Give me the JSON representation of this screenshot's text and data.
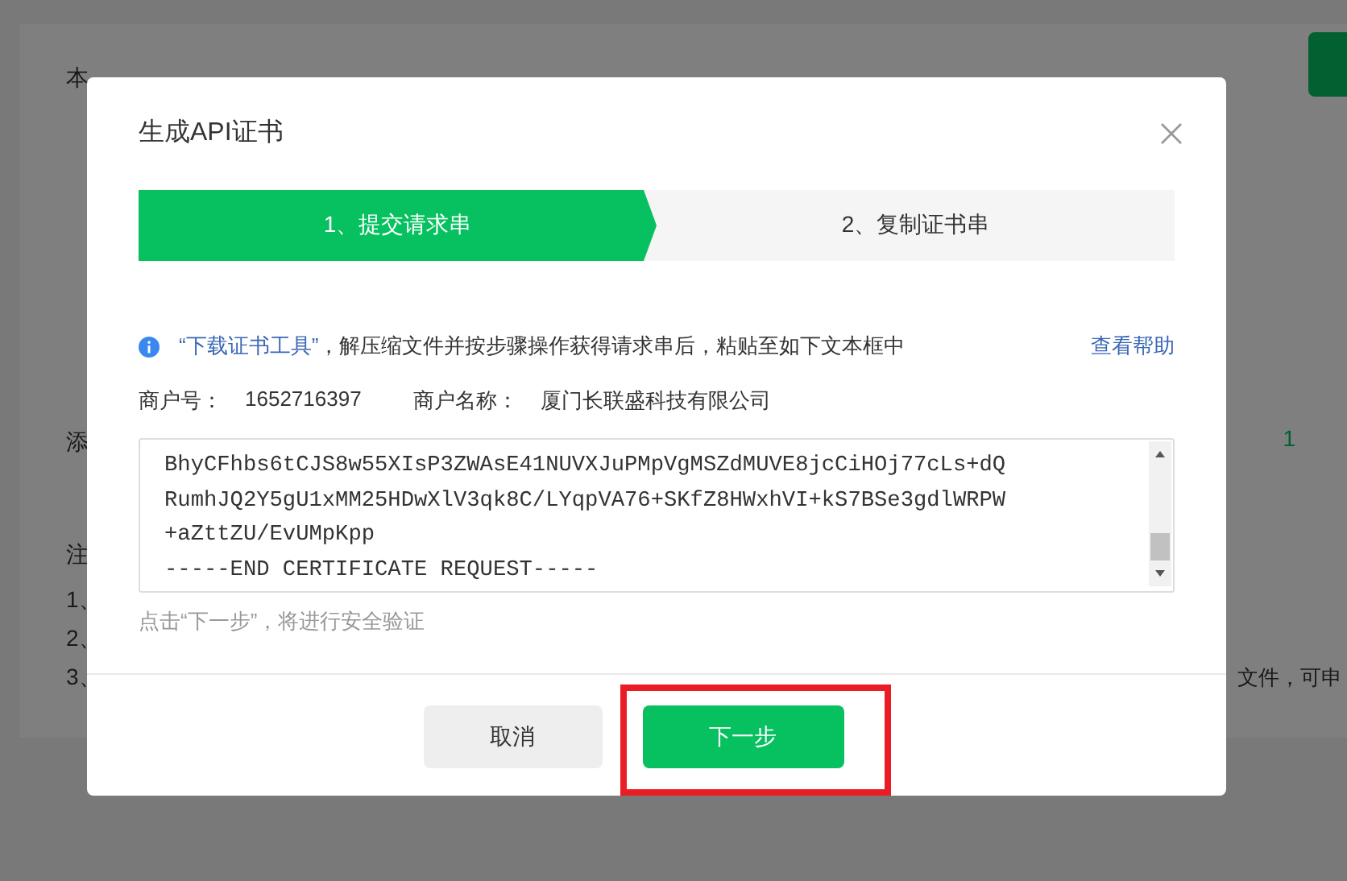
{
  "background_page": {
    "fragments": [
      {
        "text": "本"
      },
      {
        "text": "添"
      },
      {
        "text": "注"
      },
      {
        "text": "1、"
      },
      {
        "text": "2、"
      },
      {
        "text": "3、"
      }
    ],
    "count": "1",
    "trailing_text": "文件，可申"
  },
  "dialog": {
    "title": "生成API证书",
    "steps": [
      {
        "label": "1、提交请求串",
        "selected": true
      },
      {
        "label": "2、复制证书串",
        "selected": false
      }
    ],
    "notice": {
      "link": "“下载证书工具”",
      "text": "，解压缩文件并按步骤操作获得请求串后，粘贴至如下文本框中",
      "help_link": "查看帮助"
    },
    "merchant": {
      "id_label": "商户号：",
      "id": "1652716397",
      "name_label": "商户名称：",
      "name": "厦门长联盛科技有限公司"
    },
    "request_lines": [
      "BhyCFhbs6tCJS8w55XIsP3ZWAsE41NUVXJuPMpVgMSZdMUVE8jcCiHOj77cLs+dQ",
      "RumhJQ2Y5gU1xMM25HDwXlV3qk8C/LYqpVA76+SKfZ8HWxhVI+kS7BSe3gdlWRPW",
      "+aZttZU/EvUMpKpp",
      "-----END CERTIFICATE REQUEST-----"
    ],
    "hint": "点击“下一步”，将进行安全验证",
    "buttons": [
      {
        "label": "取消",
        "kind": "secondary"
      },
      {
        "label": "下一步",
        "kind": "primary",
        "highlighted": true
      }
    ]
  }
}
